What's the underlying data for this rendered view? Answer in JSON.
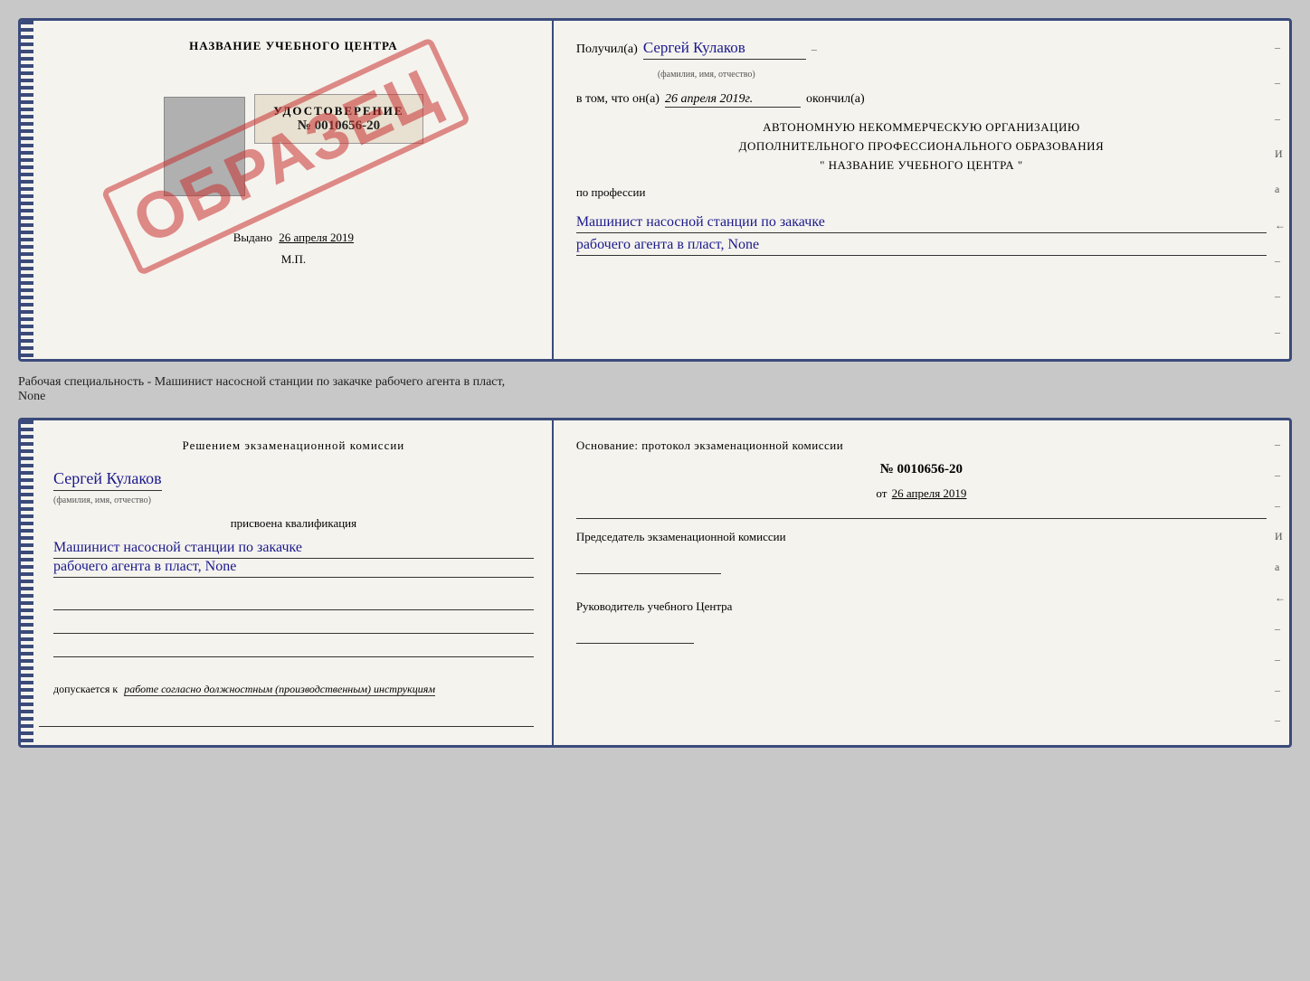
{
  "top_certificate": {
    "left": {
      "title": "НАЗВАНИЕ УЧЕБНОГО ЦЕНТРА",
      "stamp": "ОБРАЗЕЦ",
      "udostoverenie_label": "УДОСТОВЕРЕНИЕ",
      "number": "№ 0010656-20",
      "vydano_prefix": "Выдано",
      "vydano_date": "26 апреля 2019",
      "mp": "М.П."
    },
    "right": {
      "poluchil_prefix": "Получил(а)",
      "poluchil_name": "Сергей Кулаков",
      "name_hint": "(фамилия, имя, отчество)",
      "vtom_prefix": "в том, что он(а)",
      "vtom_date": "26 апреля 2019г.",
      "okonchil": "окончил(а)",
      "org_line1": "АВТОНОМНУЮ НЕКОММЕРЧЕСКУЮ ОРГАНИЗАЦИЮ",
      "org_line2": "ДОПОЛНИТЕЛЬНОГО ПРОФЕССИОНАЛЬНОГО ОБРАЗОВАНИЯ",
      "org_line3": "\"  НАЗВАНИЕ УЧЕБНОГО ЦЕНТРА  \"",
      "profession_label": "по профессии",
      "profession_line1": "Машинист насосной станции по закачке",
      "profession_line2": "рабочего агента в пласт, None",
      "dashes": [
        "-",
        "-",
        "-",
        "И",
        "а",
        "←",
        "-",
        "-",
        "-"
      ]
    }
  },
  "middle_text": "Рабочая специальность - Машинист насосной станции по закачке рабочего агента в пласт,",
  "middle_text2": "None",
  "bottom_certificate": {
    "left": {
      "komissia_title": "Решением экзаменационной комиссии",
      "name": "Сергей Кулаков",
      "name_hint": "(фамилия, имя, отчество)",
      "prisvoena": "присвоена квалификация",
      "kvalif_line1": "Машинист насосной станции по закачке",
      "kvalif_line2": "рабочего агента в пласт, None",
      "dopusk_prefix": "допускается к",
      "dopusk_text": "работе согласно должностным (производственным) инструкциям"
    },
    "right": {
      "osnov_title": "Основание: протокол экзаменационной комиссии",
      "protocol_number": "№  0010656-20",
      "protocol_date_prefix": "от",
      "protocol_date": "26 апреля 2019",
      "predsedatel_label": "Председатель экзаменационной комиссии",
      "rukovodit_label": "Руководитель учебного Центра",
      "dashes": [
        "-",
        "-",
        "-",
        "И",
        "а",
        "←",
        "-",
        "-",
        "-",
        "-"
      ]
    }
  }
}
